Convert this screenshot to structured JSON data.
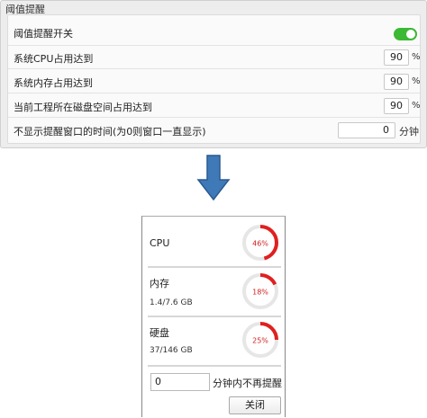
{
  "settings": {
    "title": "阈值提醒",
    "toggle_label": "阈值提醒开关",
    "toggle_on": true,
    "cpu_label": "系统CPU占用达到",
    "cpu_value": "90",
    "cpu_unit": "%",
    "mem_label": "系统内存占用达到",
    "mem_value": "90",
    "mem_unit": "%",
    "disk_label": "当前工程所在磁盘空间占用达到",
    "disk_value": "90",
    "disk_unit": "%",
    "popup_label": "不显示提醒窗口的时间(为0则窗口一直显示)",
    "popup_value": "0",
    "popup_unit": "分钟"
  },
  "popup": {
    "cpu": {
      "name": "CPU",
      "percent": 46,
      "percent_text": "46%"
    },
    "memory": {
      "name": "内存",
      "usage": "1.4/7.6 GB",
      "percent": 18,
      "percent_text": "18%"
    },
    "disk": {
      "name": "硬盘",
      "usage": "37/146 GB",
      "percent": 25,
      "percent_text": "25%"
    },
    "mute_value": "0",
    "mute_text": "分钟内不再提醒",
    "close_label": "关闭"
  },
  "colors": {
    "toggle_on": "#3bb834",
    "gauge_fill": "#e02020",
    "gauge_track": "#e6e6e6",
    "arrow": "#3f79b8"
  },
  "icons": {
    "arrow": "arrow-down-icon"
  }
}
